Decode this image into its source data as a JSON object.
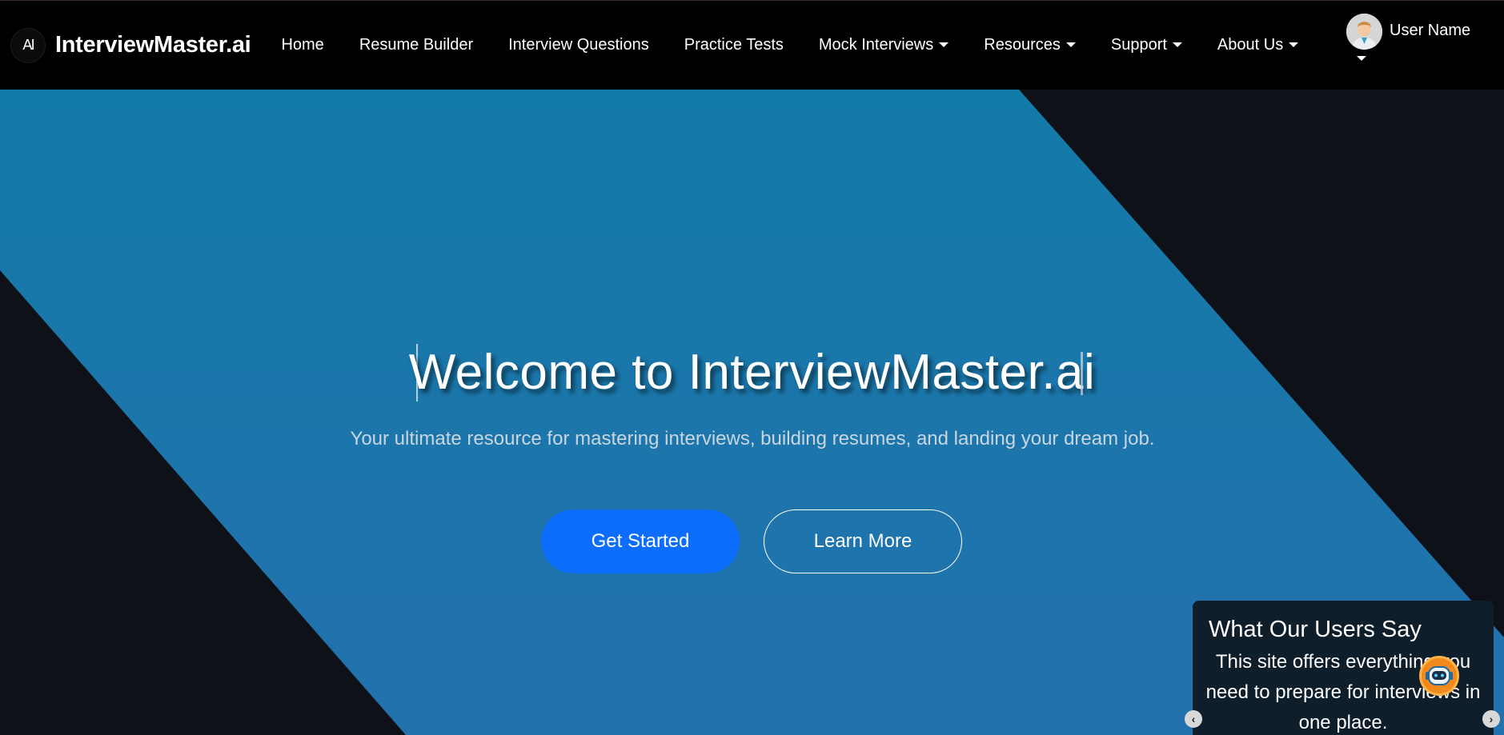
{
  "brand": {
    "logo_text": "AI",
    "name": "InterviewMaster.ai"
  },
  "nav": {
    "items": [
      {
        "label": "Home",
        "dropdown": false
      },
      {
        "label": "Resume Builder",
        "dropdown": false
      },
      {
        "label": "Interview Questions",
        "dropdown": false
      },
      {
        "label": "Practice Tests",
        "dropdown": false
      },
      {
        "label": "Mock Interviews",
        "dropdown": true
      },
      {
        "label": "Resources",
        "dropdown": true
      },
      {
        "label": "Support",
        "dropdown": true
      },
      {
        "label": "About Us",
        "dropdown": true
      }
    ]
  },
  "user": {
    "name": "User Name",
    "avatar_icon": "user-avatar-icon"
  },
  "hero": {
    "title": "Welcome to InterviewMaster.ai",
    "subtitle": "Your ultimate resource for mastering interviews, building resumes, and landing your dream job.",
    "primary_button": "Get Started",
    "secondary_button": "Learn More"
  },
  "testimonial": {
    "title": "What Our Users Say",
    "quote": "This site offers everything you need to prepare for interviews in one place.",
    "prev_icon": "chevron-left-icon",
    "next_icon": "chevron-right-icon"
  },
  "chatbot": {
    "icon": "robot-assistant-icon"
  },
  "colors": {
    "navbar_bg": "#000000",
    "hero_blue_top": "#137aa8",
    "hero_blue_bottom": "#2273ac",
    "dark_bg": "#0e1118",
    "primary": "#0d6efd",
    "testimonial_bg": "#0f1e2b"
  }
}
